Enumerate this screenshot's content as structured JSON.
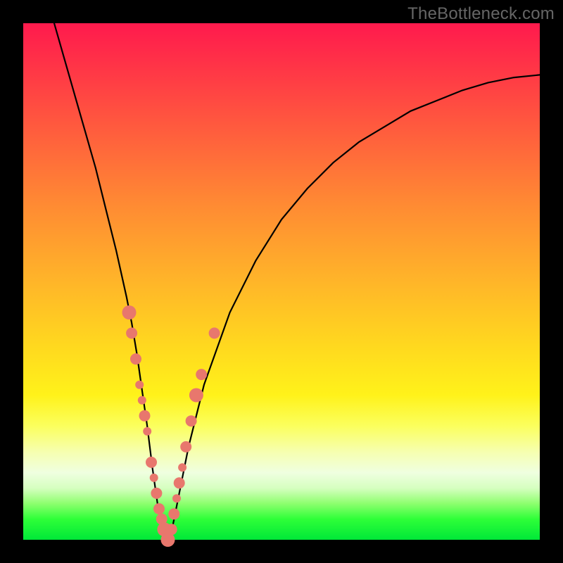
{
  "watermark": "TheBottleneck.com",
  "chart_data": {
    "type": "line",
    "title": "",
    "xlabel": "",
    "ylabel": "",
    "xlim": [
      0,
      100
    ],
    "ylim": [
      0,
      100
    ],
    "grid": false,
    "series": [
      {
        "name": "bottleneck-curve",
        "x": [
          6,
          8,
          10,
          12,
          14,
          16,
          18,
          20,
          21,
          22,
          23,
          24,
          25,
          26,
          27,
          28,
          29,
          30,
          32,
          35,
          40,
          45,
          50,
          55,
          60,
          65,
          70,
          75,
          80,
          85,
          90,
          95,
          100
        ],
        "y": [
          100,
          93,
          86,
          79,
          72,
          64,
          56,
          47,
          42,
          36,
          29,
          22,
          14,
          7,
          3,
          0,
          3,
          8,
          18,
          30,
          44,
          54,
          62,
          68,
          73,
          77,
          80,
          83,
          85,
          87,
          88.5,
          89.5,
          90
        ]
      }
    ],
    "markers": [
      {
        "x": 20.5,
        "y": 44,
        "size": "lg"
      },
      {
        "x": 21.0,
        "y": 40,
        "size": "md"
      },
      {
        "x": 21.8,
        "y": 35,
        "size": "md"
      },
      {
        "x": 22.5,
        "y": 30,
        "size": "sm"
      },
      {
        "x": 23.0,
        "y": 27,
        "size": "sm"
      },
      {
        "x": 23.5,
        "y": 24,
        "size": "md"
      },
      {
        "x": 24.0,
        "y": 21,
        "size": "sm"
      },
      {
        "x": 24.8,
        "y": 15,
        "size": "md"
      },
      {
        "x": 25.3,
        "y": 12,
        "size": "sm"
      },
      {
        "x": 25.8,
        "y": 9,
        "size": "md"
      },
      {
        "x": 26.3,
        "y": 6,
        "size": "md"
      },
      {
        "x": 26.8,
        "y": 4,
        "size": "md"
      },
      {
        "x": 27.3,
        "y": 2,
        "size": "lg"
      },
      {
        "x": 28.0,
        "y": 0,
        "size": "lg"
      },
      {
        "x": 28.7,
        "y": 2,
        "size": "md"
      },
      {
        "x": 29.2,
        "y": 5,
        "size": "md"
      },
      {
        "x": 29.7,
        "y": 8,
        "size": "sm"
      },
      {
        "x": 30.2,
        "y": 11,
        "size": "md"
      },
      {
        "x": 30.8,
        "y": 14,
        "size": "sm"
      },
      {
        "x": 31.5,
        "y": 18,
        "size": "md"
      },
      {
        "x": 32.5,
        "y": 23,
        "size": "md"
      },
      {
        "x": 33.5,
        "y": 28,
        "size": "lg"
      },
      {
        "x": 34.5,
        "y": 32,
        "size": "md"
      },
      {
        "x": 37.0,
        "y": 40,
        "size": "md"
      }
    ],
    "background_gradient_stops": [
      {
        "pos": 0,
        "color": "#ff1a4d"
      },
      {
        "pos": 50,
        "color": "#ffb529"
      },
      {
        "pos": 78,
        "color": "#fbff5e"
      },
      {
        "pos": 96,
        "color": "#2eff38"
      },
      {
        "pos": 100,
        "color": "#00e838"
      }
    ]
  }
}
